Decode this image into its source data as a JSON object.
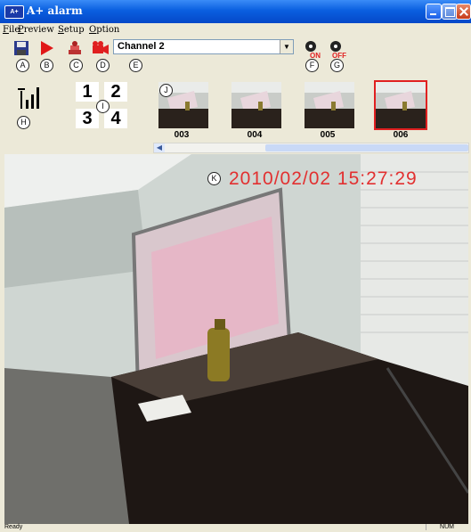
{
  "window": {
    "title": "A+ alarm",
    "icon_text": "A+"
  },
  "menu": [
    "File",
    "Preview",
    "Setup",
    "Option"
  ],
  "toolbar": {
    "badges": [
      "A",
      "B",
      "C",
      "D",
      "E",
      "F",
      "G"
    ],
    "channel_value": "Channel 2",
    "alarm_on_label": "ON",
    "alarm_off_label": "OFF"
  },
  "panel": {
    "signal_badge": "H",
    "grid": [
      "1",
      "2",
      "3",
      "4"
    ],
    "grid_badge": "I",
    "thumb_badge": "J",
    "thumbnails": [
      {
        "label": "003",
        "selected": false
      },
      {
        "label": "004",
        "selected": false
      },
      {
        "label": "005",
        "selected": false
      },
      {
        "label": "006",
        "selected": true
      }
    ]
  },
  "video": {
    "timestamp": "2010/02/02  15:27:29",
    "timestamp_badge": "K"
  },
  "status": {
    "text": "Ready",
    "num": "NUM"
  },
  "colors": {
    "titlebar": "#0a5fe0",
    "selected_border": "#e02020",
    "timestamp": "#e23030"
  }
}
